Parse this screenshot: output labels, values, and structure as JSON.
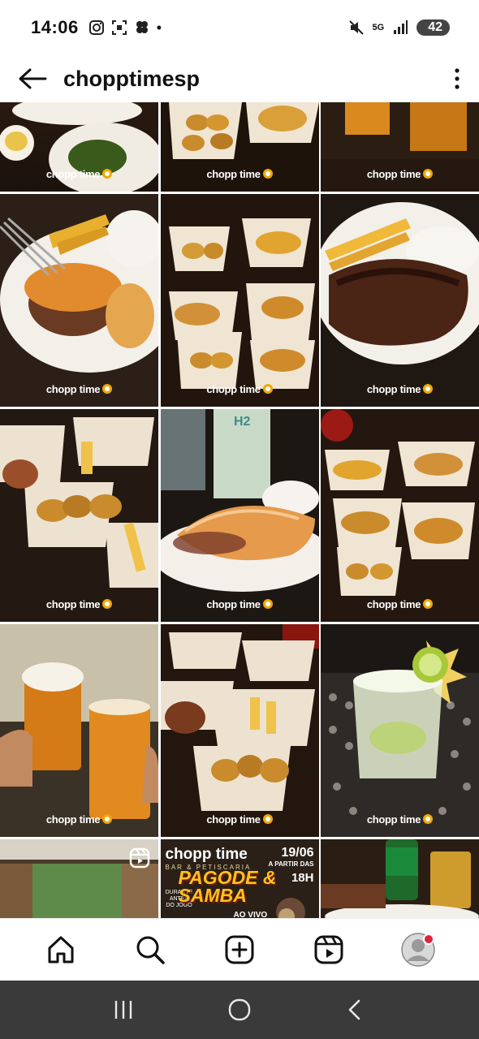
{
  "status_bar": {
    "time": "14:06",
    "dot": "•",
    "network": "5G",
    "battery": "42",
    "icons": [
      "instagram-icon",
      "scan-icon",
      "clover-icon",
      "mute-icon",
      "signal-icon",
      "battery-icon"
    ]
  },
  "header": {
    "title": "chopptimesp",
    "back_icon": "arrow-left-icon",
    "more_icon": "more-vertical-icon"
  },
  "grid": {
    "watermark_text": "chopp time",
    "tiles": [
      {
        "name": "food-plate-sides"
      },
      {
        "name": "croquettes-baskets"
      },
      {
        "name": "beer-glasses"
      },
      {
        "name": "steak-fries-rice"
      },
      {
        "name": "appetizer-baskets"
      },
      {
        "name": "grilled-steak"
      },
      {
        "name": "fried-snacks"
      },
      {
        "name": "salmon-plate"
      },
      {
        "name": "appetizer-spread"
      },
      {
        "name": "beer-toast"
      },
      {
        "name": "appetizer-baskets-2"
      },
      {
        "name": "caipirinha"
      },
      {
        "name": "restaurant-interior"
      },
      {
        "name": "pagode-samba-flyer"
      },
      {
        "name": "guarana-drink"
      }
    ],
    "promo": {
      "brand": "chopp time",
      "sub": "BAR & PETISCARIA",
      "headline_1": "PAGODE &",
      "headline_2": "SAMBA",
      "ao_vivo": "AO VIVO",
      "date": "19/06",
      "date_sub": "A PARTIR DAS",
      "time": "18H",
      "tag": "DURANTE ANTES DO JOGO"
    }
  },
  "bottom_nav": {
    "items": [
      "home-icon",
      "search-icon",
      "create-icon",
      "reels-icon",
      "profile-avatar"
    ]
  },
  "system_nav": {
    "items": [
      "recents-icon",
      "home-circle-icon",
      "back-chevron-icon"
    ]
  },
  "colors": {
    "accent": "#f0a800",
    "notification": "#e0243a",
    "system_bar": "#3a3a3a"
  }
}
